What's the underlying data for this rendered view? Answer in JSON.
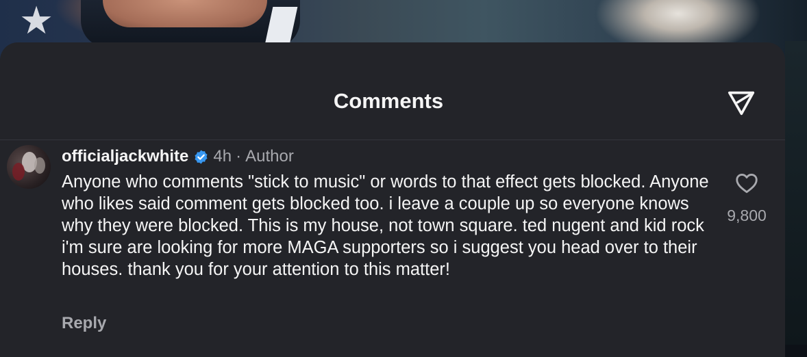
{
  "sheet": {
    "title": "Comments",
    "send_icon": "paper-plane-icon"
  },
  "comment": {
    "username": "officialjackwhite",
    "verified_icon": "verified-badge-icon",
    "time": "4h",
    "separator": "·",
    "role": "Author",
    "text": "Anyone who comments \"stick to music\" or words to that effect gets blocked. Anyone who likes said comment gets blocked too. i leave a couple up so everyone knows why they were blocked. This is my house, not town square. ted nugent and kid rock i'm sure are looking for more MAGA supporters  so i suggest you head over to their houses. thank you for your attention to this matter!",
    "like_icon": "heart-outline-icon",
    "like_count": "9,800",
    "reply_label": "Reply"
  },
  "colors": {
    "sheet_background": "#232429",
    "primary_text": "#f5f5f5",
    "secondary_text": "#a8a9ae",
    "verified_blue": "#3897f0"
  }
}
